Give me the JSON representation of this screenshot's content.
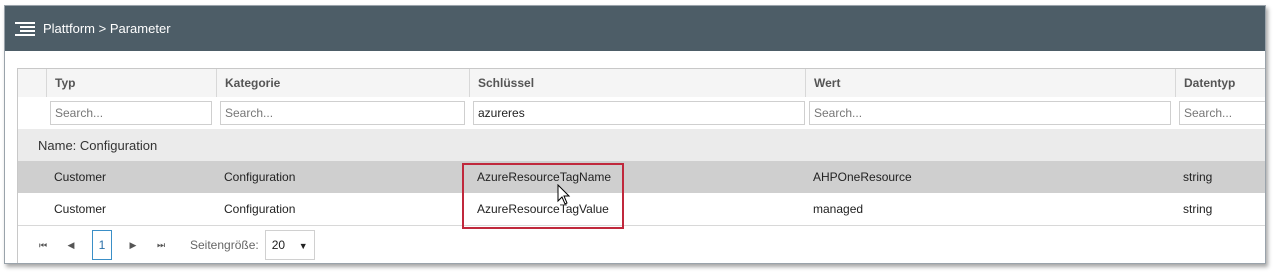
{
  "header": {
    "title": "Plattform > Parameter"
  },
  "columns": [
    "Typ",
    "Kategorie",
    "Schlüssel",
    "Wert",
    "Datentyp"
  ],
  "filters": [
    {
      "placeholder": "Search...",
      "value": ""
    },
    {
      "placeholder": "Search...",
      "value": ""
    },
    {
      "placeholder": "",
      "value": "azureres"
    },
    {
      "placeholder": "Search...",
      "value": ""
    },
    {
      "placeholder": "Search...",
      "value": ""
    }
  ],
  "group": {
    "label": "Name: Configuration"
  },
  "rows": [
    {
      "typ": "Customer",
      "kategorie": "Configuration",
      "schluessel": "AzureResourceTagName",
      "wert": "AHPOneResource",
      "datentyp": "string"
    },
    {
      "typ": "Customer",
      "kategorie": "Configuration",
      "schluessel": "AzureResourceTagValue",
      "wert": "managed",
      "datentyp": "string"
    }
  ],
  "pager": {
    "first": "⏮",
    "prev": "◀",
    "next": "▶",
    "last": "⏭",
    "current_page": "1",
    "page_size_label": "Seitengröße:",
    "page_size": "20"
  },
  "colors": {
    "titlebar": "#4d5d67",
    "highlight": "#c0283c",
    "selected_row": "#cfcfcf",
    "group_row": "#ebebeb"
  }
}
